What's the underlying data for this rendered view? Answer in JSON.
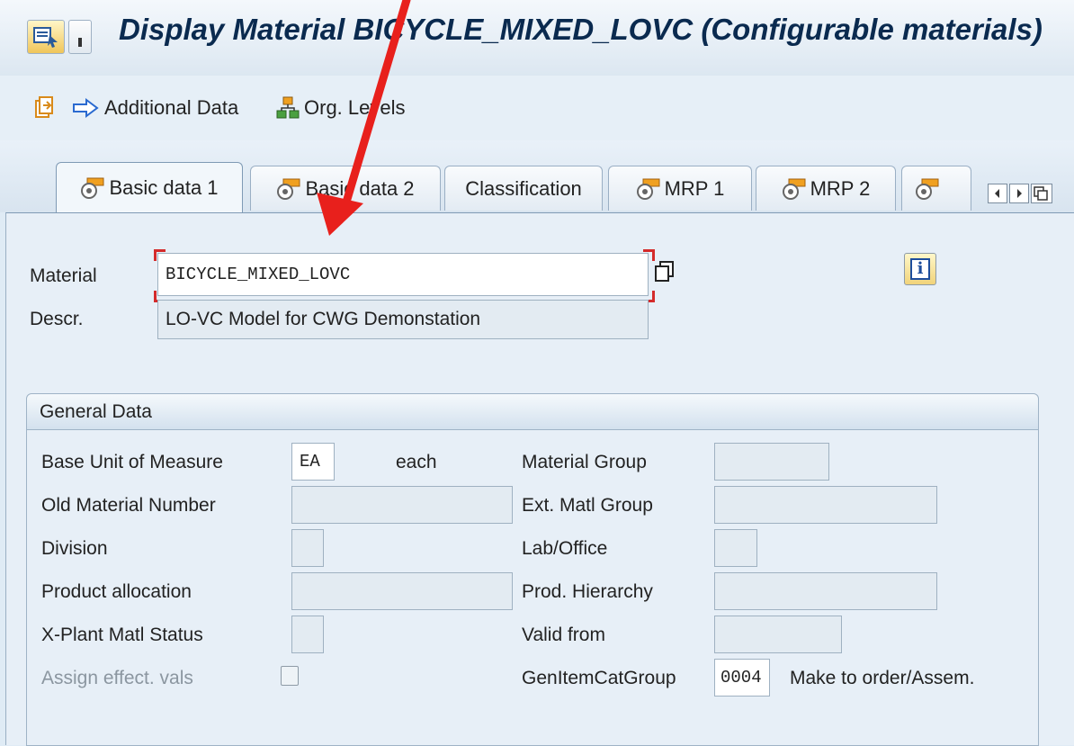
{
  "window": {
    "title": "Display Material BICYCLE_MIXED_LOVC (Configurable materials)"
  },
  "toolbar": {
    "additional_data_label": "Additional Data",
    "org_levels_label": "Org. Levels"
  },
  "tabs": [
    {
      "label": "Basic data 1",
      "active": true
    },
    {
      "label": "Basic data 2",
      "active": false
    },
    {
      "label": "Classification",
      "active": false
    },
    {
      "label": "MRP 1",
      "active": false
    },
    {
      "label": "MRP 2",
      "active": false
    }
  ],
  "header": {
    "material_label": "Material",
    "material_value": "BICYCLE_MIXED_LOVC",
    "descr_label": "Descr.",
    "descr_value": "LO-VC Model for CWG Demonstation"
  },
  "general_data": {
    "title": "General Data",
    "base_uom_label": "Base Unit of Measure",
    "base_uom_value": "EA",
    "base_uom_text": "each",
    "old_material_label": "Old Material Number",
    "old_material_value": "",
    "division_label": "Division",
    "division_value": "",
    "product_allocation_label": "Product allocation",
    "product_allocation_value": "",
    "xplant_status_label": "X-Plant Matl Status",
    "xplant_status_value": "",
    "assign_effect_label": "Assign effect. vals",
    "assign_effect_checked": false,
    "material_group_label": "Material Group",
    "material_group_value": "",
    "ext_matl_group_label": "Ext. Matl Group",
    "ext_matl_group_value": "",
    "lab_office_label": "Lab/Office",
    "lab_office_value": "",
    "prod_hierarchy_label": "Prod. Hierarchy",
    "prod_hierarchy_value": "",
    "valid_from_label": "Valid from",
    "valid_from_value": "",
    "gen_item_cat_label": "GenItemCatGroup",
    "gen_item_cat_value": "0004",
    "gen_item_cat_text": "Make to order/Assem."
  },
  "colors": {
    "annotation_arrow": "#e8201c",
    "title_text": "#0a2a4f",
    "panel_bg": "#e7eff7"
  }
}
